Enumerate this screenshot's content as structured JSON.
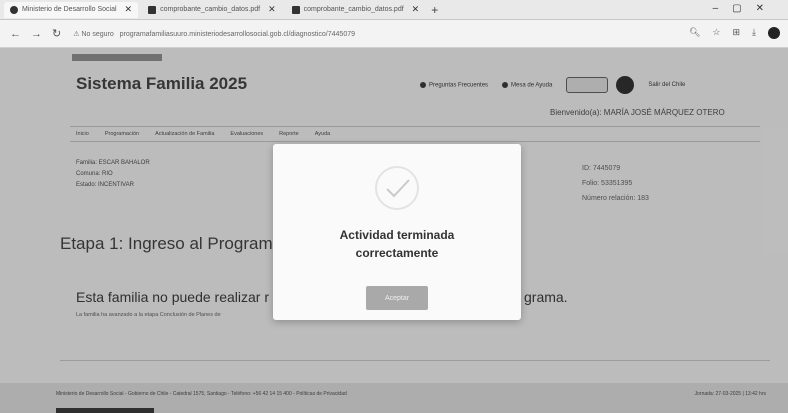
{
  "browser": {
    "tabs": [
      {
        "label": "Ministerio de Desarrollo Social",
        "active": true
      },
      {
        "label": "comprobante_cambio_datos.pdf",
        "active": false
      },
      {
        "label": "comprobante_cambio_datos.pdf",
        "active": false
      }
    ],
    "security": "No seguro",
    "url": "programafamiliasuuro.ministeriodesarrollosocial.gob.cl/diagnostico/7445079"
  },
  "header": {
    "title": "Sistema Familia 2025",
    "links": [
      "Preguntas Frecuentes",
      "Mesa de Ayuda",
      "Salir del Chile"
    ],
    "welcome": "Bienvenido(a): MARÍA JOSÉ MÁRQUEZ OTERO"
  },
  "menu": [
    "Inicio",
    "Programación",
    "Actualización de Familia",
    "Evaluaciones",
    "Reporte",
    "Ayuda"
  ],
  "family": {
    "left": [
      "Familia: ESCAR BAHALOR",
      "Comuna: RIO",
      "Estado: INCENTIVAR"
    ],
    "right": [
      "ID: 7445079",
      "Folio: 53351395",
      "Número relación: 183"
    ]
  },
  "main": {
    "stage_title": "Etapa 1: Ingreso al Programa",
    "notice_start": "Esta familia no puede realizar r",
    "notice_end": "grama.",
    "subnotice": "La familia ha avanzado a la etapa Conclusión de Planes de"
  },
  "footer": {
    "left": "Ministerio de Desarrollo Social - Gobierno de Chile - Catedral 1575, Santiago - Teléfono: +56 42 14 15 400 - Políticas de Privacidad",
    "right": "Jornada: 27-03-2025 | 13:42 hrs"
  },
  "modal": {
    "title": "Actividad terminada correctamente",
    "ok_label": "Aceptar"
  }
}
